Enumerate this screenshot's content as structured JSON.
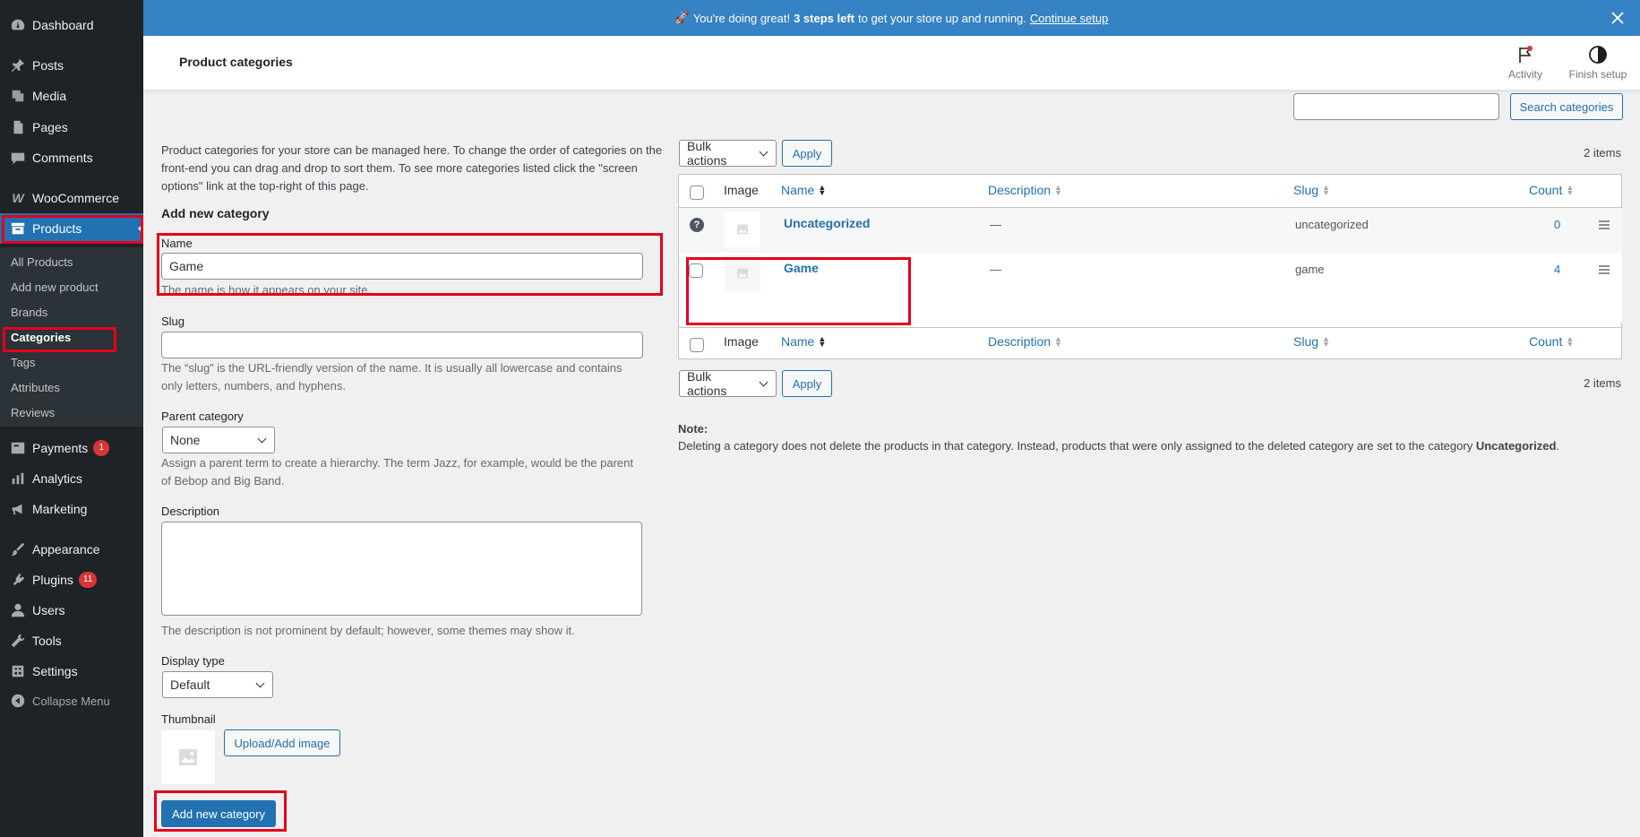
{
  "sidebar": {
    "items": [
      {
        "label": "Dashboard",
        "icon": "dashboard-icon"
      },
      {
        "label": "Posts",
        "icon": "pin-icon"
      },
      {
        "label": "Media",
        "icon": "media-icon"
      },
      {
        "label": "Pages",
        "icon": "pages-icon"
      },
      {
        "label": "Comments",
        "icon": "comments-icon"
      },
      {
        "label": "WooCommerce",
        "icon": "woocommerce-icon"
      },
      {
        "label": "Products",
        "icon": "archive-icon"
      },
      {
        "label": "Payments",
        "icon": "payments-icon",
        "badge": "1"
      },
      {
        "label": "Analytics",
        "icon": "analytics-icon"
      },
      {
        "label": "Marketing",
        "icon": "megaphone-icon"
      },
      {
        "label": "Appearance",
        "icon": "brush-icon"
      },
      {
        "label": "Plugins",
        "icon": "plugin-icon",
        "badge": "11"
      },
      {
        "label": "Users",
        "icon": "user-icon"
      },
      {
        "label": "Tools",
        "icon": "wrench-icon"
      },
      {
        "label": "Settings",
        "icon": "settings-icon"
      },
      {
        "label": "Collapse Menu",
        "icon": "collapse-icon"
      }
    ],
    "submenu": [
      "All Products",
      "Add new product",
      "Brands",
      "Categories",
      "Tags",
      "Attributes",
      "Reviews"
    ]
  },
  "banner": {
    "emoji": "🚀",
    "text_before": "You're doing great!",
    "bold": "3 steps left",
    "text_after": "to get your store up and running.",
    "link": "Continue setup"
  },
  "header": {
    "title": "Product categories",
    "activity": "Activity",
    "finish_setup": "Finish setup"
  },
  "search": {
    "value": "",
    "button": "Search categories"
  },
  "intro": "Product categories for your store can be managed here. To change the order of categories on the front-end you can drag and drop to sort them. To see more categories listed click the \"screen options\" link at the top-right of this page.",
  "form": {
    "heading": "Add new category",
    "name_label": "Name",
    "name_value": "Game",
    "name_help": "The name is how it appears on your site.",
    "slug_label": "Slug",
    "slug_value": "",
    "slug_help": "The “slug” is the URL-friendly version of the name. It is usually all lowercase and contains only letters, numbers, and hyphens.",
    "parent_label": "Parent category",
    "parent_value": "None",
    "parent_help": "Assign a parent term to create a hierarchy. The term Jazz, for example, would be the parent of Bebop and Big Band.",
    "description_label": "Description",
    "description_value": "",
    "description_help": "The description is not prominent by default; however, some themes may show it.",
    "display_label": "Display type",
    "display_value": "Default",
    "thumbnail_label": "Thumbnail",
    "upload_button": "Upload/Add image",
    "submit_button": "Add new category"
  },
  "table": {
    "bulk_actions": "Bulk actions",
    "apply": "Apply",
    "items_count": "2 items",
    "columns": {
      "image": "Image",
      "name": "Name",
      "description": "Description",
      "slug": "Slug",
      "count": "Count"
    },
    "rows": [
      {
        "name": "Uncategorized",
        "description": "—",
        "slug": "uncategorized",
        "count": "0"
      },
      {
        "name": "Game",
        "description": "—",
        "slug": "game",
        "count": "4"
      }
    ]
  },
  "note": {
    "label": "Note:",
    "text": "Deleting a category does not delete the products in that category. Instead, products that were only assigned to the deleted category are set to the category",
    "bold": "Uncategorized",
    "end": "."
  },
  "colors": {
    "sidebar_bg": "#1d2327",
    "accent": "#2271b1",
    "banner": "#3582c4",
    "highlight": "#e3001b",
    "badge": "#d63638"
  }
}
